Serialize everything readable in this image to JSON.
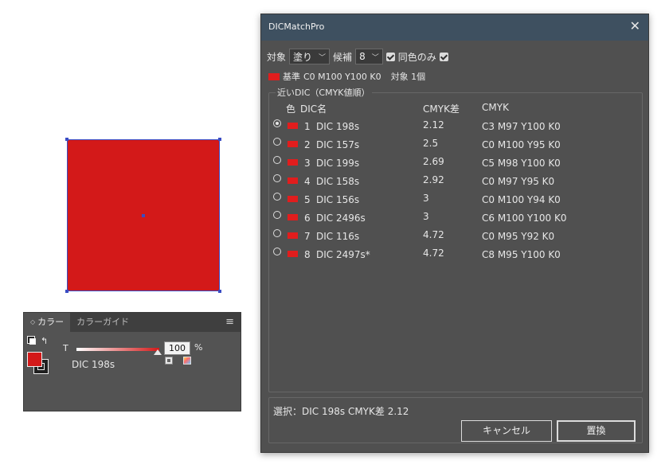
{
  "artboard": {
    "fill_color": "#d31919",
    "selection_color": "#3a4cc4"
  },
  "color_panel": {
    "tabs": [
      {
        "label": "カラー",
        "active": true
      },
      {
        "label": "カラーガイド",
        "active": false
      }
    ],
    "tab_arrow_icon": "◇",
    "menu_icon": "≡",
    "tint_label": "T",
    "tint_value": "100",
    "tint_unit": "%",
    "swatch_name": "DIC 198s"
  },
  "dialog": {
    "title": "DICMatchPro",
    "close_icon": "✕",
    "target_label": "対象",
    "target_value": "塗り",
    "candidates_label": "候補",
    "candidates_value": "8",
    "same_color_only_label": "同色のみ",
    "base_label": "基準",
    "base_value": "C0  M100  Y100  K0",
    "target_count": "対象 1個",
    "group_title": "近いDIC（CMYK値順）",
    "headers": {
      "color": "色",
      "name": "DIC名",
      "diff": "CMYK差",
      "cmyk": "CMYK"
    },
    "rows": [
      {
        "idx": "1",
        "name": "DIC 198s",
        "diff": "2.12",
        "cmyk": "C3 M97 Y100 K0"
      },
      {
        "idx": "2",
        "name": "DIC 157s",
        "diff": "2.5",
        "cmyk": "C0 M100 Y95 K0"
      },
      {
        "idx": "3",
        "name": "DIC 199s",
        "diff": "2.69",
        "cmyk": "C5 M98 Y100 K0"
      },
      {
        "idx": "4",
        "name": "DIC 158s",
        "diff": "2.92",
        "cmyk": "C0 M97 Y95 K0"
      },
      {
        "idx": "5",
        "name": "DIC 156s",
        "diff": "3",
        "cmyk": "C0 M100 Y94 K0"
      },
      {
        "idx": "6",
        "name": "DIC 2496s",
        "diff": "3",
        "cmyk": "C6 M100 Y100 K0"
      },
      {
        "idx": "7",
        "name": "DIC 116s",
        "diff": "4.72",
        "cmyk": "C0 M95 Y92 K0"
      },
      {
        "idx": "8",
        "name": "DIC 2497s*",
        "diff": "4.72",
        "cmyk": "C8 M95 Y100 K0"
      }
    ],
    "selected_row": 1,
    "status": "選択：DIC  198s   CMYK差 2.12",
    "cancel_label": "キャンセル",
    "replace_label": "置換"
  }
}
